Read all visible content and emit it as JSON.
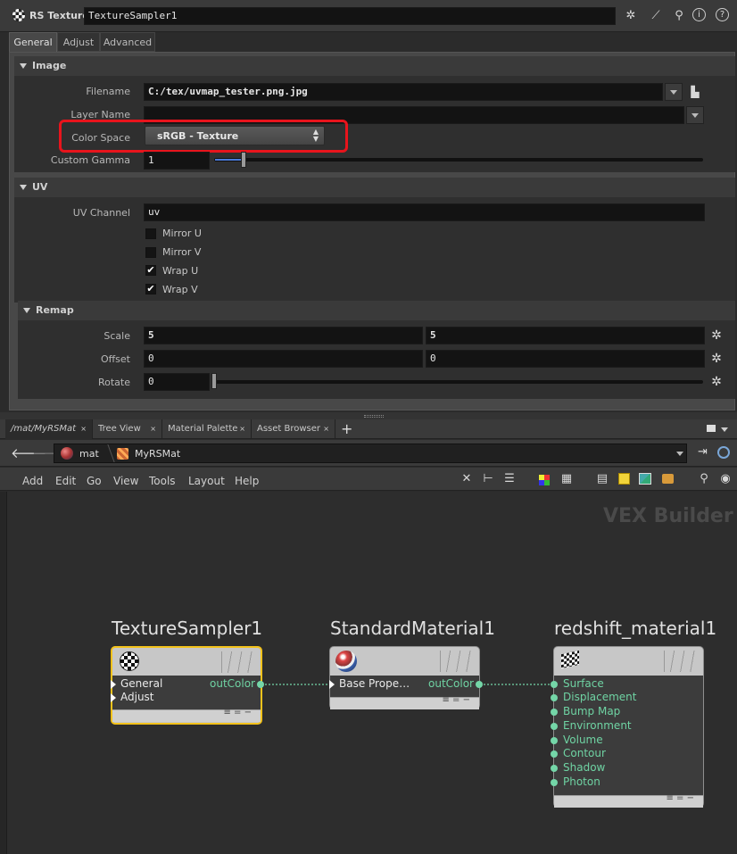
{
  "header": {
    "node_type": "RS Texture",
    "node_name": "TextureSampler1"
  },
  "param_tabs": [
    "General",
    "Adjust",
    "Advanced"
  ],
  "image_section": {
    "title": "Image",
    "filename_label": "Filename",
    "filename_value": "C:/tex/uvmap_tester.png.jpg",
    "layer_name_label": "Layer Name",
    "layer_name_value": "",
    "color_space_label": "Color Space",
    "color_space_value": "sRGB - Texture",
    "custom_gamma_label": "Custom Gamma",
    "custom_gamma_value": "1",
    "gamma_slider_fraction": 0.06
  },
  "uv_section": {
    "title": "UV",
    "uv_channel_label": "UV Channel",
    "uv_channel_value": "uv",
    "mirror_u": "Mirror U",
    "mirror_v": "Mirror V",
    "wrap_u": "Wrap U",
    "wrap_v": "Wrap V"
  },
  "remap_section": {
    "title": "Remap",
    "scale_label": "Scale",
    "scale_values": [
      "5",
      "5"
    ],
    "offset_label": "Offset",
    "offset_values": [
      "0",
      "0"
    ],
    "rotate_label": "Rotate",
    "rotate_value": "0"
  },
  "pane_tabs": [
    "/mat/MyRSMat",
    "Tree View",
    "Material Palette",
    "Asset Browser"
  ],
  "path": {
    "segment1": "mat",
    "segment2": "MyRSMat"
  },
  "menu": [
    "Add",
    "Edit",
    "Go",
    "View",
    "Tools",
    "Layout",
    "Help"
  ],
  "network_label": "VEX Builder",
  "nodes": {
    "texture_sampler": {
      "title": "TextureSampler1",
      "inputs": [
        "General",
        "Adjust"
      ],
      "output": "outColor"
    },
    "standard_material": {
      "title": "StandardMaterial1",
      "input": "Base Prope…",
      "output": "outColor"
    },
    "redshift_material": {
      "title": "redshift_material1",
      "inputs": [
        "Surface",
        "Displacement",
        "Bump Map",
        "Environment",
        "Volume",
        "Contour",
        "Shadow",
        "Photon"
      ]
    }
  },
  "colors": {
    "highlight_red": "#e8141c",
    "selected_yellow": "#f3c21b",
    "port_green": "#74d6a8"
  }
}
